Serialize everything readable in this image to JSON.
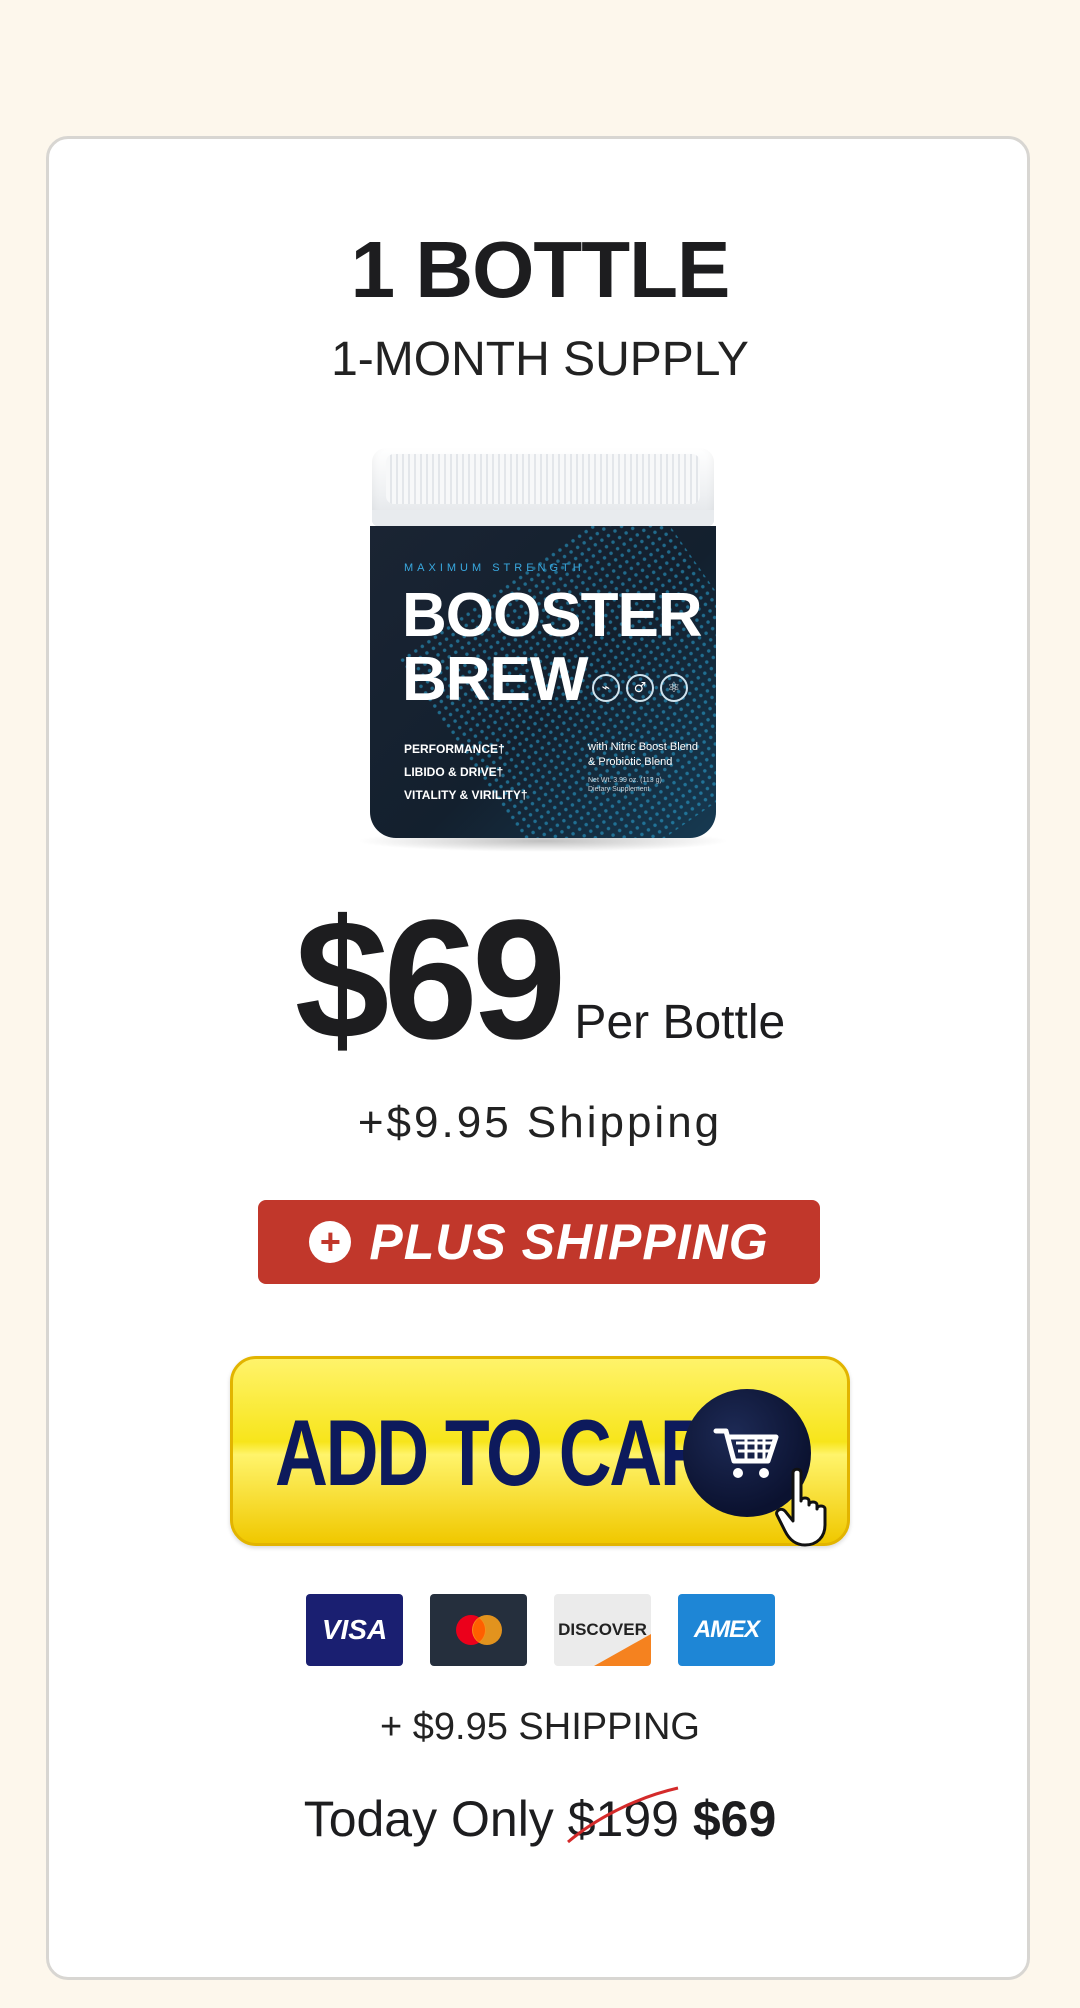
{
  "package": {
    "title": "1 BOTTLE",
    "subtitle": "1-MONTH SUPPLY"
  },
  "product": {
    "tagline": "MAXIMUM STRENGTH",
    "brand_line1": "BOOSTER",
    "brand_line2": "BREW",
    "benefits": [
      "PERFORMANCE†",
      "LIBIDO & DRIVE†",
      "VITALITY & VIRILITY†"
    ],
    "blend": "with Nitric Boost Blend & Probiotic Blend",
    "net_weight": "Net Wt. 3.99 oz. (113 g)",
    "supplement": "Dietary Supplement",
    "icons": [
      "gauge-icon",
      "male-icon",
      "atom-icon"
    ]
  },
  "price": {
    "amount": "$69",
    "unit": "Per Bottle",
    "shipping": "+$9.95 Shipping"
  },
  "badge": {
    "label": "PLUS SHIPPING",
    "color": "#c1372b"
  },
  "cart": {
    "label": "ADD TO CART"
  },
  "payments": {
    "visa": "VISA",
    "discover": "DISCOVER",
    "amex": "AMEX"
  },
  "footer": {
    "shipping": "+ $9.95 SHIPPING",
    "today_prefix": "Today Only",
    "old_price": "$199",
    "new_price": "$69"
  },
  "colors": {
    "background": "#fdf7ec",
    "button_yellow": "#f7e51b",
    "button_text": "#0d1a5c",
    "strike": "#d42a2a"
  }
}
